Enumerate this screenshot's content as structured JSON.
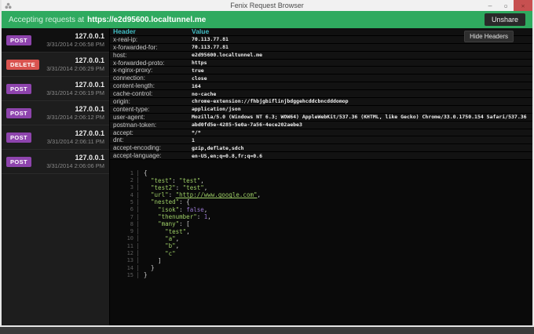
{
  "window": {
    "title": "Fenix Request Browser",
    "icons": {
      "minimize": "–",
      "maximize": "▫",
      "close": "✕"
    }
  },
  "banner": {
    "label": "Accepting requests at",
    "url": "https://e2d95600.localtunnel.me",
    "unshare_label": "Unshare",
    "background_color": "#2faa5f"
  },
  "sidebar": {
    "method_colors": {
      "POST": "#8e44ad",
      "DELETE": "#d9534f"
    },
    "requests": [
      {
        "method": "POST",
        "ip": "127.0.0.1",
        "time": "3/31/2014 2:06:58 PM",
        "selected": true
      },
      {
        "method": "DELETE",
        "ip": "127.0.0.1",
        "time": "3/31/2014 2:06:29 PM"
      },
      {
        "method": "POST",
        "ip": "127.0.0.1",
        "time": "3/31/2014 2:06:19 PM"
      },
      {
        "method": "POST",
        "ip": "127.0.0.1",
        "time": "3/31/2014 2:06:12 PM"
      },
      {
        "method": "POST",
        "ip": "127.0.0.1",
        "time": "3/31/2014 2:06:11 PM"
      },
      {
        "method": "POST",
        "ip": "127.0.0.1",
        "time": "3/31/2014 2:06:06 PM"
      }
    ]
  },
  "headers": {
    "hide_button_label": "Hide Headers",
    "columns": [
      "Header",
      "Value"
    ],
    "column_color": "#41bdc4",
    "rows": [
      {
        "name": "x-real-ip:",
        "value": "70.113.77.81"
      },
      {
        "name": "x-forwarded-for:",
        "value": "70.113.77.81"
      },
      {
        "name": "host:",
        "value": "e2d95600.localtunnel.me"
      },
      {
        "name": "x-forwarded-proto:",
        "value": "https"
      },
      {
        "name": "x-nginx-proxy:",
        "value": "true"
      },
      {
        "name": "connection:",
        "value": "close"
      },
      {
        "name": "content-length:",
        "value": "164"
      },
      {
        "name": "cache-control:",
        "value": "no-cache"
      },
      {
        "name": "origin:",
        "value": "chrome-extension://fhbjgbiflinjbdggehcddcbncdddomop"
      },
      {
        "name": "content-type:",
        "value": "application/json"
      },
      {
        "name": "user-agent:",
        "value": "Mozilla/5.0 (Windows NT 6.3; WOW64) AppleWebKit/537.36 (KHTML, like Gecko) Chrome/33.0.1750.154 Safari/537.36"
      },
      {
        "name": "postman-token:",
        "value": "abd0fd5e-4285-5e0a-7a56-4ece202aebe3"
      },
      {
        "name": "accept:",
        "value": "*/*"
      },
      {
        "name": "dnt:",
        "value": "1"
      },
      {
        "name": "accept-encoding:",
        "value": "gzip,deflate,sdch"
      },
      {
        "name": "accept-language:",
        "value": "en-US,en;q=0.8,fr;q=0.6"
      }
    ]
  },
  "body_json": {
    "syntax_colors": {
      "string": "#9ccc65",
      "literal": "#9575cd",
      "punctuation": "#d6d6d6"
    },
    "lines": [
      {
        "num": "1",
        "tokens": [
          {
            "type": "punc",
            "text": "{"
          }
        ]
      },
      {
        "num": "2",
        "tokens": [
          {
            "type": "punc",
            "text": "  "
          },
          {
            "type": "key",
            "text": "\"test\""
          },
          {
            "type": "punc",
            "text": ": "
          },
          {
            "type": "str",
            "text": "\"test\""
          },
          {
            "type": "punc",
            "text": ","
          }
        ]
      },
      {
        "num": "3",
        "tokens": [
          {
            "type": "punc",
            "text": "  "
          },
          {
            "type": "key",
            "text": "\"test2\""
          },
          {
            "type": "punc",
            "text": ": "
          },
          {
            "type": "str",
            "text": "\"test\""
          },
          {
            "type": "punc",
            "text": ","
          }
        ]
      },
      {
        "num": "4",
        "tokens": [
          {
            "type": "punc",
            "text": "  "
          },
          {
            "type": "key",
            "text": "\"url\""
          },
          {
            "type": "punc",
            "text": ": "
          },
          {
            "type": "link",
            "text": "\"http://www.google.com\""
          },
          {
            "type": "punc",
            "text": ","
          }
        ]
      },
      {
        "num": "5",
        "tokens": [
          {
            "type": "punc",
            "text": "  "
          },
          {
            "type": "key",
            "text": "\"nested\""
          },
          {
            "type": "punc",
            "text": ": {"
          }
        ]
      },
      {
        "num": "6",
        "tokens": [
          {
            "type": "punc",
            "text": "    "
          },
          {
            "type": "key",
            "text": "\"isok\""
          },
          {
            "type": "punc",
            "text": ": "
          },
          {
            "type": "bool",
            "text": "false"
          },
          {
            "type": "punc",
            "text": ","
          }
        ]
      },
      {
        "num": "7",
        "tokens": [
          {
            "type": "punc",
            "text": "    "
          },
          {
            "type": "key",
            "text": "\"thenumber\""
          },
          {
            "type": "punc",
            "text": ": "
          },
          {
            "type": "num",
            "text": "1"
          },
          {
            "type": "punc",
            "text": ","
          }
        ]
      },
      {
        "num": "8",
        "tokens": [
          {
            "type": "punc",
            "text": "    "
          },
          {
            "type": "key",
            "text": "\"many\""
          },
          {
            "type": "punc",
            "text": ": ["
          }
        ]
      },
      {
        "num": "9",
        "tokens": [
          {
            "type": "punc",
            "text": "      "
          },
          {
            "type": "str",
            "text": "\"test\""
          },
          {
            "type": "punc",
            "text": ","
          }
        ]
      },
      {
        "num": "10",
        "tokens": [
          {
            "type": "punc",
            "text": "      "
          },
          {
            "type": "str",
            "text": "\"a\""
          },
          {
            "type": "punc",
            "text": ","
          }
        ]
      },
      {
        "num": "11",
        "tokens": [
          {
            "type": "punc",
            "text": "      "
          },
          {
            "type": "str",
            "text": "\"b\""
          },
          {
            "type": "punc",
            "text": ","
          }
        ]
      },
      {
        "num": "12",
        "tokens": [
          {
            "type": "punc",
            "text": "      "
          },
          {
            "type": "str",
            "text": "\"c\""
          }
        ]
      },
      {
        "num": "13",
        "tokens": [
          {
            "type": "punc",
            "text": "    ]"
          }
        ]
      },
      {
        "num": "14",
        "tokens": [
          {
            "type": "punc",
            "text": "  }"
          }
        ]
      },
      {
        "num": "15",
        "tokens": [
          {
            "type": "punc",
            "text": "}"
          }
        ]
      }
    ]
  }
}
